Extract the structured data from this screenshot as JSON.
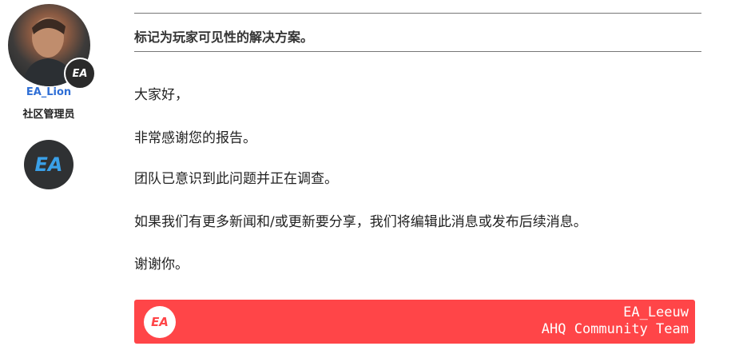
{
  "author": {
    "username": "EA_Lion",
    "role": "社区管理员",
    "avatar_badge_text": "EA",
    "rank_badge_text": "EA"
  },
  "solution_header": {
    "text": "标记为玩家可见性的解决方案。"
  },
  "post": {
    "paragraphs": [
      "大家好，",
      "非常感谢您的报告。",
      "团队已意识到此问题并正在调查。",
      "如果我们有更多新闻和/或更新要分享，我们将编辑此消息或发布后续消息。",
      "谢谢你。"
    ]
  },
  "signature": {
    "logo_text": "EA",
    "line1": "EA_Leeuw",
    "line2": "AHQ Community Team"
  },
  "colors": {
    "username": "#2f6fd6",
    "signature_bg": "#ff4548",
    "rank_badge_bg": "#2f3133",
    "rank_badge_fg": "#3aa0e8"
  }
}
